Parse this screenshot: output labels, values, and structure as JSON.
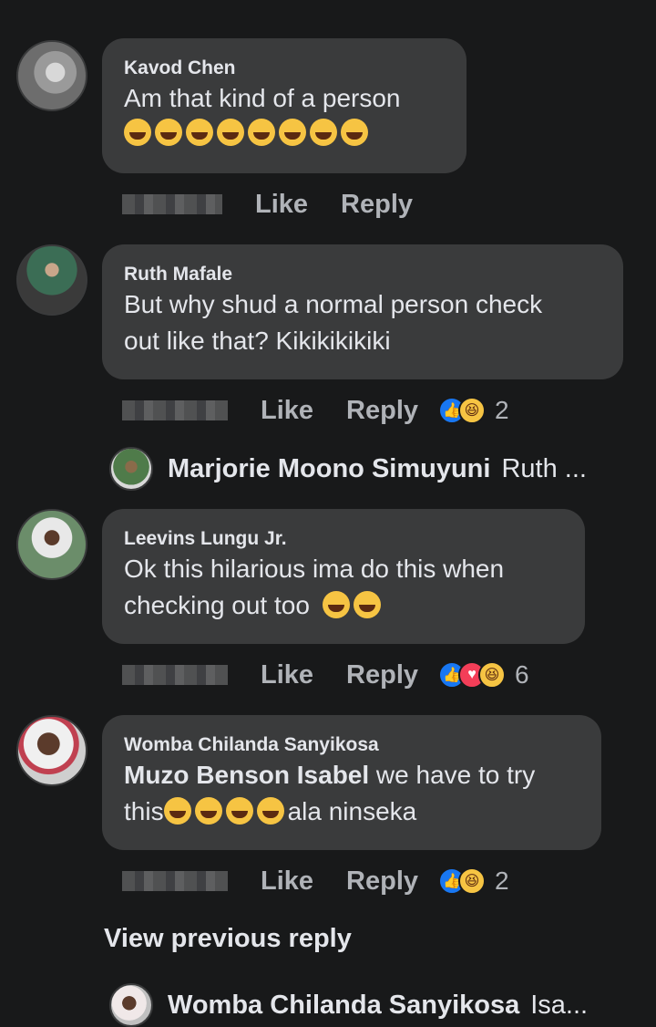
{
  "comments": [
    {
      "author": "Kavod Chen",
      "text": "Am that kind of a person",
      "emoji_line": "😅🤣😂🤣😂🤣😅😂",
      "like": "Like",
      "reply": "Reply"
    },
    {
      "author": "Ruth Mafale",
      "text1": "But why shud a normal person check",
      "text2": "out like that? Kikikikikiki",
      "like": "Like",
      "reply": "Reply",
      "reactions_count": "2"
    },
    {
      "author": "Leevins Lungu Jr.",
      "text1": "Ok this hilarious ima do this when",
      "text2": "checking out too",
      "like": "Like",
      "reply": "Reply",
      "reactions_count": "6"
    },
    {
      "author": "Womba Chilanda Sanyikosa",
      "mention": "Muzo Benson Isabel",
      "text1": " we have to try",
      "text2a": "this",
      "text2b": "ala ninseka",
      "like": "Like",
      "reply": "Reply",
      "reactions_count": "2"
    }
  ],
  "replies": [
    {
      "name": "Marjorie Moono Simuyuni",
      "snippet": "Ruth ..."
    },
    {
      "name": "Womba Chilanda Sanyikosa",
      "snippet": "Isa..."
    }
  ],
  "view_previous": "View previous reply",
  "colors": {
    "background": "#18191a",
    "bubble": "#3a3b3c",
    "secondary_text": "#b0b3b8",
    "like_blue": "#1877f2"
  }
}
